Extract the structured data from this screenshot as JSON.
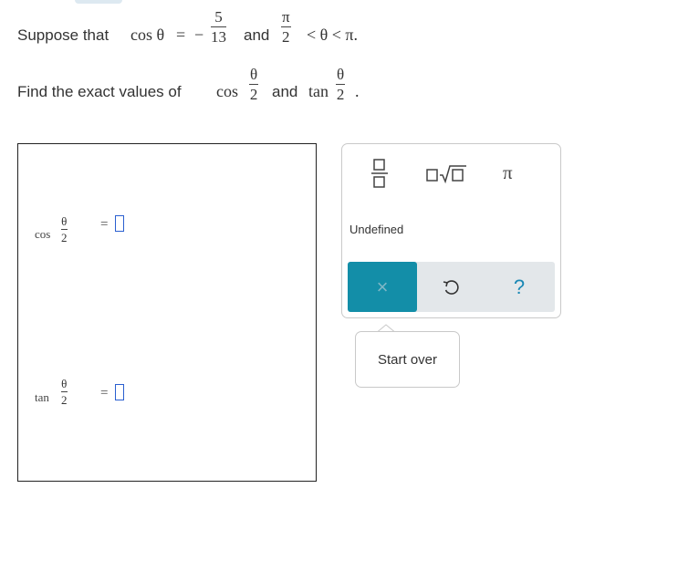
{
  "problem": {
    "line1": {
      "lead": "Suppose that",
      "func": "cos θ",
      "equals": "=",
      "minus": "−",
      "frac1_num": "5",
      "frac1_den": "13",
      "and": "and",
      "frac2_num": "π",
      "frac2_den": "2",
      "ineq": "< θ < π."
    },
    "line2": {
      "lead": "Find the exact values of",
      "cos": "cos",
      "and": "and",
      "tan": "tan",
      "half_num": "θ",
      "half_den": "2",
      "period": "."
    }
  },
  "answers": [
    {
      "func": "cos",
      "num": "θ",
      "den": "2",
      "equals": "="
    },
    {
      "func": "tan",
      "num": "θ",
      "den": "2",
      "equals": "="
    }
  ],
  "palette": {
    "fraction_icon": "fraction-icon",
    "sqrt_icon": "square-root-icon",
    "pi_label": "π",
    "undefined_label": "Undefined",
    "clear_label": "×",
    "undo_icon": "undo-icon",
    "help_label": "?"
  },
  "tooltip": {
    "label": "Start over"
  },
  "colors": {
    "accent": "#138ea8",
    "slot_border": "#2a5fd0",
    "help": "#1a88b5"
  }
}
